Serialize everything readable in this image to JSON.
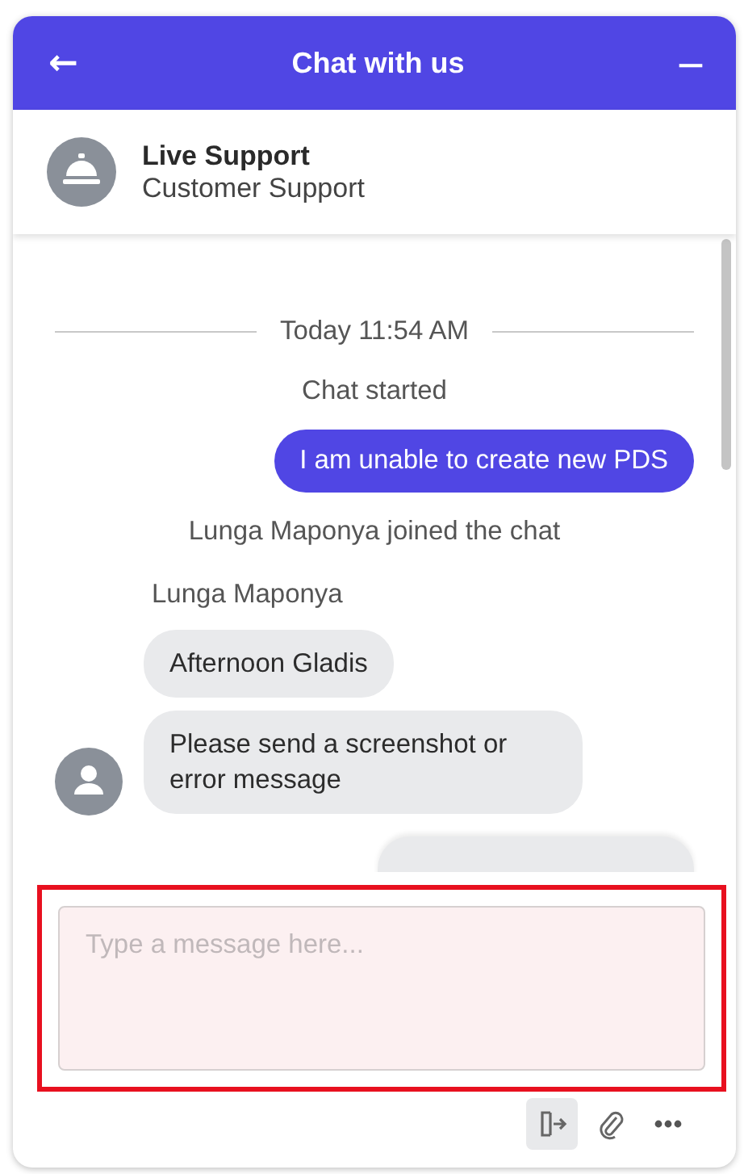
{
  "header": {
    "title": "Chat with us",
    "back_icon": "←",
    "minimize_icon": "—"
  },
  "agent": {
    "name": "Live Support",
    "role": "Customer Support"
  },
  "messages": [
    {
      "kind": "divider",
      "text": "Today 11:54 AM"
    },
    {
      "kind": "system",
      "text": "Chat started"
    },
    {
      "kind": "outgoing",
      "text": "I am unable to create new PDS"
    },
    {
      "kind": "system",
      "text": "Lunga Maponya joined the chat"
    },
    {
      "kind": "sender",
      "text": "Lunga Maponya"
    },
    {
      "kind": "incoming",
      "text": "Afternoon Gladis",
      "avatar": false
    },
    {
      "kind": "incoming",
      "text": "Please send a screenshot or error message",
      "avatar": true
    },
    {
      "kind": "outgoing_cut"
    }
  ],
  "compose": {
    "placeholder": "Type a message here...",
    "highlighted": true
  },
  "toolbar": [
    {
      "kind": "exit",
      "selected": true
    },
    {
      "kind": "attach",
      "selected": false
    },
    {
      "kind": "more",
      "selected": false
    }
  ]
}
